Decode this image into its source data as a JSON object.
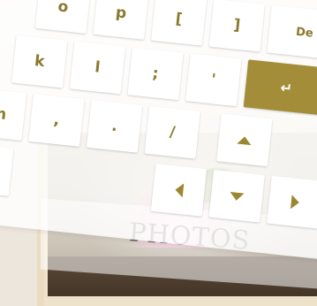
{
  "keyboard": {
    "row1": [
      "o",
      "p",
      "[",
      "]",
      "De"
    ],
    "row2": [
      "k",
      "l",
      ";",
      "'"
    ],
    "row3": [
      "m",
      ",",
      ".",
      "/"
    ],
    "enter_icon": "return-arrow-icon",
    "enter_glyph": "↵",
    "accent_color": "#a38d39",
    "arrows": [
      "up-arrow-icon",
      "left-arrow-icon",
      "down-arrow-icon",
      "right-arrow-icon"
    ]
  },
  "background": {
    "section_title": "PHOTOS"
  }
}
